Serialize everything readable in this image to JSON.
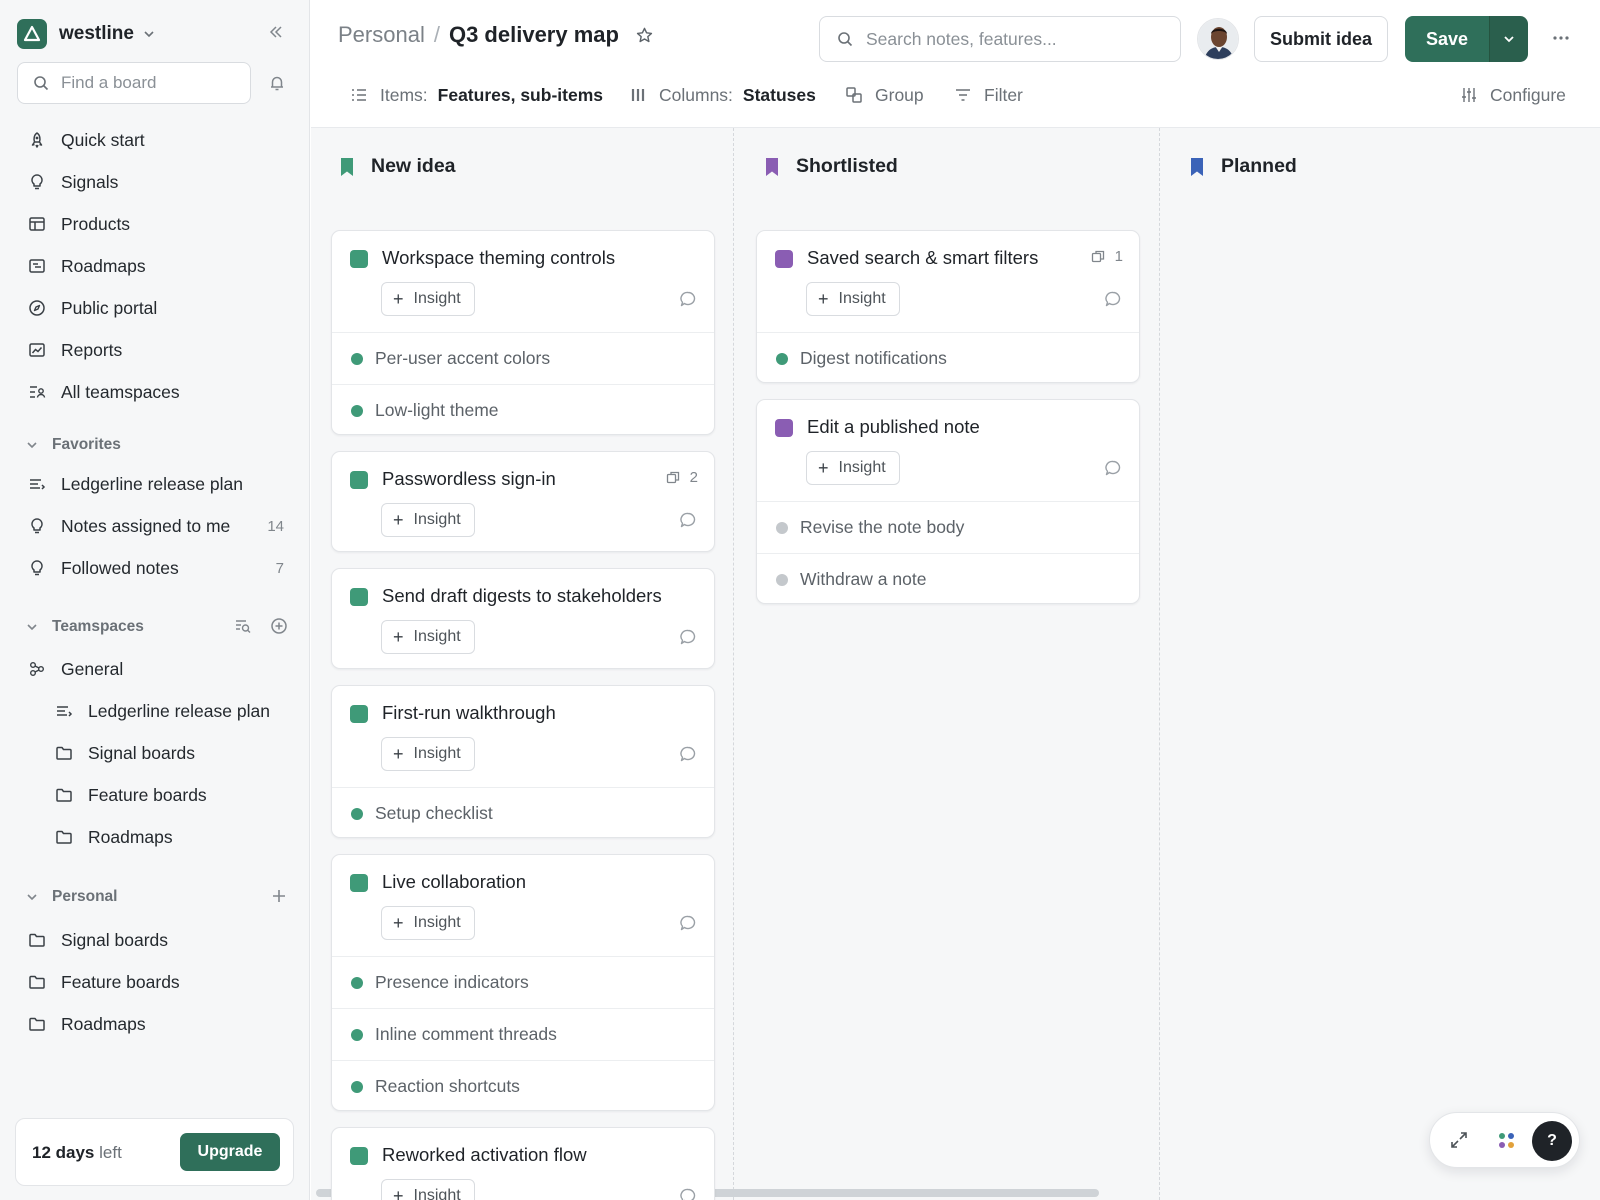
{
  "workspace": {
    "name": "westline"
  },
  "sidebar": {
    "find_placeholder": "Find a board",
    "nav": [
      {
        "label": "Quick start",
        "icon": "rocket-icon"
      },
      {
        "label": "Signals",
        "icon": "lightbulb-icon"
      },
      {
        "label": "Products",
        "icon": "products-icon"
      },
      {
        "label": "Roadmaps",
        "icon": "roadmap-icon"
      },
      {
        "label": "Public portal",
        "icon": "compass-icon"
      },
      {
        "label": "Reports",
        "icon": "chart-icon"
      },
      {
        "label": "All teamspaces",
        "icon": "teamspaces-icon"
      }
    ],
    "favorites": {
      "title": "Favorites",
      "items": [
        {
          "label": "Ledgerline release plan",
          "icon": "release-plan-icon"
        },
        {
          "label": "Notes assigned to me",
          "icon": "lightbulb-icon",
          "count": "14"
        },
        {
          "label": "Followed notes",
          "icon": "lightbulb-icon",
          "count": "7"
        }
      ]
    },
    "teamspaces": {
      "title": "Teamspaces",
      "general": "General",
      "items": [
        {
          "label": "Ledgerline release plan",
          "icon": "release-plan-icon"
        },
        {
          "label": "Signal boards",
          "icon": "folder-icon"
        },
        {
          "label": "Feature boards",
          "icon": "folder-icon"
        },
        {
          "label": "Roadmaps",
          "icon": "folder-icon"
        }
      ]
    },
    "personal": {
      "title": "Personal",
      "items": [
        {
          "label": "Signal boards",
          "icon": "folder-icon"
        },
        {
          "label": "Feature boards",
          "icon": "folder-icon"
        },
        {
          "label": "Roadmaps",
          "icon": "folder-icon"
        }
      ]
    },
    "trial": {
      "days": "12 days",
      "suffix": "left",
      "upgrade_label": "Upgrade"
    }
  },
  "header": {
    "breadcrumb_parent": "Personal",
    "breadcrumb_sep": "/",
    "title": "Q3 delivery map",
    "search_placeholder": "Search notes, features...",
    "submit_label": "Submit idea",
    "save_label": "Save"
  },
  "toolbar": {
    "items_label": "Items:",
    "items_value": "Features, sub-items",
    "columns_label": "Columns:",
    "columns_value": "Statuses",
    "group_label": "Group",
    "filter_label": "Filter",
    "configure_label": "Configure"
  },
  "colors": {
    "brand": "#2f6f5a",
    "new_idea": "#3f9a78",
    "shortlisted": "#8a5db3",
    "planned": "#3b63b8",
    "dot_active": "#3f9a78",
    "dot_inactive": "#c4c8cc"
  },
  "board": {
    "insight_label": "Insight",
    "columns": [
      {
        "title": "New idea",
        "cards": [
          {
            "title": "Workspace theming controls",
            "subs": [
              "Per-user accent colors",
              "Low-light theme"
            ]
          },
          {
            "title": "Passwordless sign-in",
            "links": "2",
            "subs": []
          },
          {
            "title": "Send draft digests to stakeholders",
            "subs": []
          },
          {
            "title": "First-run walkthrough",
            "subs": [
              "Setup checklist"
            ]
          },
          {
            "title": "Live collaboration",
            "subs": [
              "Presence indicators",
              "Inline comment threads",
              "Reaction shortcuts"
            ]
          },
          {
            "title": "Reworked activation flow",
            "subs": []
          }
        ]
      },
      {
        "title": "Shortlisted",
        "cards": [
          {
            "title": "Saved search & smart filters",
            "links": "1",
            "subs": [
              "Digest notifications"
            ]
          },
          {
            "title": "Edit a published note",
            "subs": [
              "Revise the note body",
              "Withdraw a note"
            ]
          }
        ]
      },
      {
        "title": "Planned",
        "cards": []
      }
    ]
  },
  "dock": {
    "help_label": "?"
  }
}
